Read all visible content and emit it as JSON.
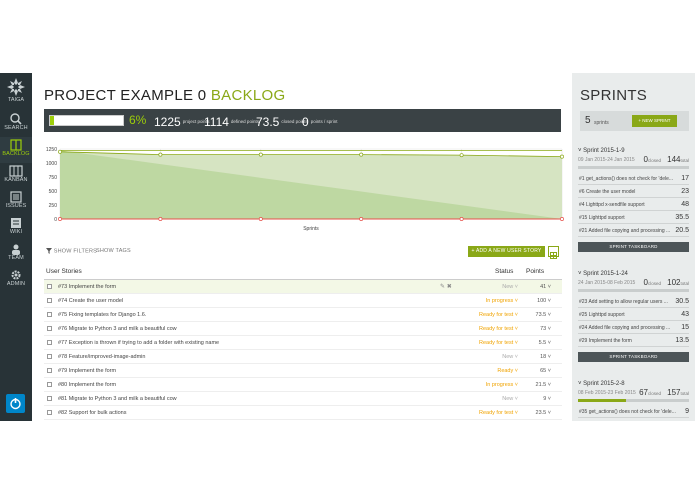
{
  "nav": {
    "logo_text": "TAIGA",
    "items": [
      {
        "label": "SEARCH",
        "icon": "search-icon"
      },
      {
        "label": "BACKLOG",
        "icon": "backlog-icon"
      },
      {
        "label": "KANBAN",
        "icon": "kanban-icon"
      },
      {
        "label": "ISSUES",
        "icon": "issues-icon"
      },
      {
        "label": "WIKI",
        "icon": "wiki-icon"
      },
      {
        "label": "TEAM",
        "icon": "team-icon"
      },
      {
        "label": "ADMIN",
        "icon": "admin-icon"
      }
    ],
    "active": "BACKLOG"
  },
  "page": {
    "title_main": "PROJECT EXAMPLE 0",
    "title_accent": "BACKLOG"
  },
  "summary": {
    "progress": 0.06,
    "progress_label": "6%",
    "project_points": "1225",
    "project_points_label": "project points",
    "defined_points": "1114",
    "defined_points_label": "defined points",
    "closed_points": "73.5",
    "closed_points_label": "closed points",
    "points_sprint": "0",
    "points_sprint_label": "points / sprint"
  },
  "chart_data": {
    "type": "area",
    "xlabel": "Sprints",
    "ylabel": "",
    "ylim": [
      0,
      1250
    ],
    "yticks": [
      0,
      250,
      500,
      750,
      1000,
      1250
    ],
    "x": [
      0,
      1,
      2,
      3,
      4,
      5
    ],
    "series": [
      {
        "values": [
          1225,
          1225,
          1225,
          1225,
          1225,
          1225
        ]
      },
      {
        "values": [
          1200,
          1150,
          1150,
          1150,
          1140,
          1114
        ]
      },
      {
        "values": [
          1225,
          980,
          735,
          490,
          245,
          0
        ]
      },
      {
        "values": [
          0,
          0,
          0,
          0,
          0,
          0
        ]
      }
    ],
    "colors": {
      "optimal": "#d6e4c2",
      "real": "#b8d49a",
      "line_top": "#8aa817",
      "line_zero": "#e5504a"
    }
  },
  "filters": {
    "show_filters": "SHOW FILTERS",
    "show_tags": "SHOW TAGS",
    "add_story": "+ ADD A NEW USER STORY"
  },
  "table": {
    "col_story": "User Stories",
    "col_status": "Status",
    "col_points": "Points",
    "rows": [
      {
        "subject": "#73 Implement the form",
        "status": "New",
        "points": "41"
      },
      {
        "subject": "#74 Create the user model",
        "status": "In progress",
        "points": "100"
      },
      {
        "subject": "#75 Fixing templates for Django 1.6.",
        "status": "Ready for test",
        "points": "73.5"
      },
      {
        "subject": "#76 Migrate to Python 3 and milk a beautiful cow",
        "status": "Ready for test",
        "points": "73"
      },
      {
        "subject": "#77 Exception is thrown if trying to add a folder with existing name",
        "status": "Ready for test",
        "points": "5.5"
      },
      {
        "subject": "#78 Feature/improved-image-admin",
        "status": "New",
        "points": "18"
      },
      {
        "subject": "#79 Implement the form",
        "status": "Ready",
        "points": "65"
      },
      {
        "subject": "#80 Implement the form",
        "status": "In progress",
        "points": "21.5"
      },
      {
        "subject": "#81 Migrate to Python 3 and milk a beautiful cow",
        "status": "New",
        "points": "9"
      },
      {
        "subject": "#82 Support for bulk actions",
        "status": "Ready for test",
        "points": "23.5"
      }
    ]
  },
  "sprints": {
    "title": "SPRINTS",
    "count": "5",
    "count_label": "sprints",
    "new_sprint": "+ NEW SPRINT",
    "taskboard": "SPRINT TASKBOARD",
    "list": [
      {
        "name": "Sprint 2015-1-9",
        "dates": "09 Jan 2015-24 Jan 2015",
        "closed": "0",
        "closed_label": "closed",
        "total": "144",
        "total_label": "total",
        "progress": 0.0,
        "items": [
          {
            "subject": "#1 get_actions() does not check for 'dele...",
            "points": "17"
          },
          {
            "subject": "#6 Create the user model",
            "points": "23"
          },
          {
            "subject": "#4 Lighttpd x-sendfile support",
            "points": "48"
          },
          {
            "subject": "#15 Lighttpd support",
            "points": "35.5"
          },
          {
            "subject": "#21 Added file copying and processing ...",
            "points": "20.5"
          }
        ]
      },
      {
        "name": "Sprint 2015-1-24",
        "dates": "24 Jan 2015-08 Feb 2015",
        "closed": "0",
        "closed_label": "closed",
        "total": "102",
        "total_label": "total",
        "progress": 0.0,
        "items": [
          {
            "subject": "#23 Add setting to allow regular users ...",
            "points": "30.5"
          },
          {
            "subject": "#25 Lighttpd support",
            "points": "43"
          },
          {
            "subject": "#24 Added file copying and processing ...",
            "points": "15"
          },
          {
            "subject": "#29 Implement the form",
            "points": "13.5"
          }
        ]
      },
      {
        "name": "Sprint 2015-2-8",
        "dates": "08 Feb 2015-23 Feb 2015",
        "closed": "67",
        "closed_label": "closed",
        "total": "157",
        "total_label": "total",
        "progress": 0.43,
        "items": [
          {
            "subject": "#35 get_actions() does not check for 'dele...",
            "points": "9"
          }
        ]
      }
    ]
  }
}
